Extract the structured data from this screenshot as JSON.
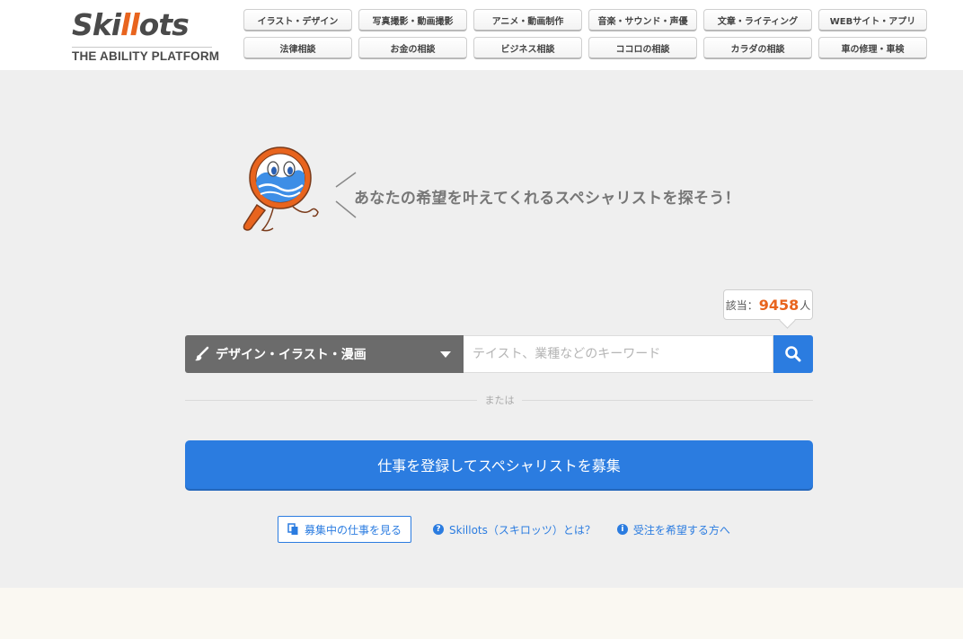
{
  "logo": {
    "word_a": "Ski",
    "word_b": "ll",
    "word_c": "ots",
    "tagline": "THE ABILITY PLATFORM"
  },
  "categories": [
    "イラスト・デザイン",
    "写真撮影・動画撮影",
    "アニメ・動画制作",
    "音楽・サウンド・声優",
    "文章・ライティング",
    "WEBサイト・アプリ",
    "法律相談",
    "お金の相談",
    "ビジネス相談",
    "ココロの相談",
    "カラダの相談",
    "車の修理・車検"
  ],
  "hero": {
    "text": "あなたの希望を叶えてくれるスペシャリストを探そう！"
  },
  "count": {
    "prefix": "該当：",
    "value": "9458",
    "suffix": "人"
  },
  "search": {
    "category": "デザイン・イラスト・漫画",
    "placeholder": "テイスト、業種などのキーワード",
    "icon": "search-icon"
  },
  "or_text": "または",
  "post_button": "仕事を登録してスペシャリストを募集",
  "links": {
    "view_jobs": "募集中の仕事を見る",
    "about": "Skillots（スキロッツ）とは？",
    "for_workers": "受注を希望する方へ"
  },
  "colors": {
    "brand_orange": "#e8641e",
    "accent_blue": "#2b7ce0",
    "gray_select": "#6b6b6b"
  }
}
